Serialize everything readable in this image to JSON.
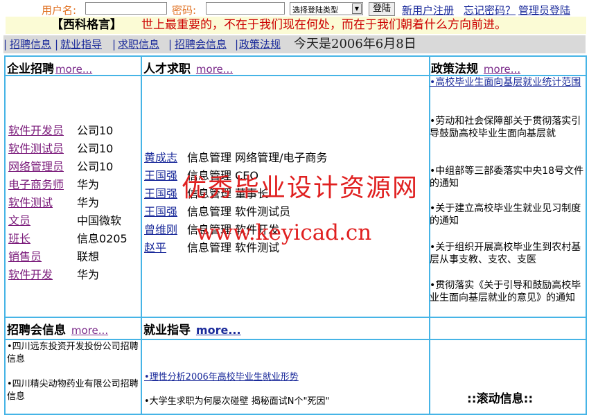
{
  "login": {
    "username_label": "用户名:",
    "username_value": "",
    "password_label": "密码:",
    "password_value": "",
    "login_type": "选择登陆类型",
    "login_button": "登陆",
    "register_link": "新用户注册",
    "forgot_link": "忘记密码？",
    "admin_link": "管理员登陆"
  },
  "motto": {
    "title": "【西科格言】",
    "text": "世上最重要的，不在于我们现在何处，而在于我们朝着什么方向前进。"
  },
  "nav": {
    "items": [
      "招聘信息",
      "就业指导",
      "求职信息",
      "招聘会信息",
      "政策法规"
    ],
    "today": "今天是2006年6月8日"
  },
  "sections": {
    "jobs": {
      "title": "企业招聘",
      "more": "more..."
    },
    "seekers": {
      "title": "人才求职",
      "more": "more..."
    },
    "policy": {
      "title": "政策法规",
      "more": "more..."
    },
    "fairs": {
      "title": "招聘会信息",
      "more": "more..."
    },
    "guide": {
      "title": "就业指导",
      "more": "more..."
    },
    "scroll": {
      "title": "::滚动信息::"
    }
  },
  "jobs": [
    {
      "position": "软件开发员",
      "company": "公司10"
    },
    {
      "position": "软件测试员",
      "company": "公司10"
    },
    {
      "position": "网络管理员",
      "company": "公司10"
    },
    {
      "position": "电子商务师",
      "company": "华为"
    },
    {
      "position": "软件测试",
      "company": "华为"
    },
    {
      "position": "文员",
      "company": "中国微软"
    },
    {
      "position": "班长",
      "company": "信息0205"
    },
    {
      "position": "销售员",
      "company": "联想"
    },
    {
      "position": "软件开发",
      "company": "华为"
    }
  ],
  "seekers": [
    {
      "name": "黄成志",
      "detail": "信息管理 网络管理/电子商务"
    },
    {
      "name": "王国强",
      "detail": "信息管理 CEO"
    },
    {
      "name": "王国强",
      "detail": "信息管理 董事长"
    },
    {
      "name": "王国强",
      "detail": "信息管理 软件测试员"
    },
    {
      "name": "曾维刚",
      "detail": "信息管理 软件开发"
    },
    {
      "name": "赵平",
      "detail": "信息管理 软件测试"
    }
  ],
  "policy": [
    {
      "text": "•高校毕业生面向基层就业统计范围"
    },
    {
      "text": "•劳动和社会保障部关于贯彻落实引导鼓励高校毕业生面向基层就"
    },
    {
      "text": "•中组部等三部委落实中央18号文件的通知"
    },
    {
      "text": "•关于建立高校毕业生就业见习制度的通知"
    },
    {
      "text": "•关于组织开展高校毕业生到农村基层从事支教、支农、支医"
    },
    {
      "text": "•贯彻落实《关于引导和鼓励高校毕业生面向基层就业的意见》的通知"
    }
  ],
  "fairs": [
    {
      "text": "•四川远东投资开发投份公司招聘信息"
    },
    {
      "text": "•四川精尖动物药业有限公司招聘信息"
    }
  ],
  "guide": [
    {
      "text": "•理性分析2006年高校毕业生就业形势"
    },
    {
      "text": "•大学生求职为何屡次碰壁 揭秘面试N个\"死因\""
    }
  ],
  "watermark": {
    "line1": "优秀毕业设计资源网",
    "line2": "www.keyicad.cn"
  }
}
